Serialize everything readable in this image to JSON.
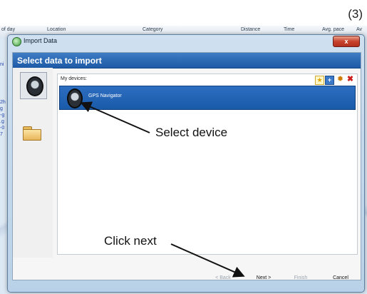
{
  "step_number": "(3)",
  "background_app": {
    "columns": [
      "of day",
      "Location",
      "Category",
      "Distance",
      "Time",
      "Avg. pace",
      "Av"
    ],
    "side_fragments": [
      "ni",
      "2h",
      "g",
      "-g",
      ".g",
      "-0",
      "7"
    ]
  },
  "dialog": {
    "title": "Import Data",
    "close_glyph": "x",
    "header_title": "Select data to import",
    "my_devices_label": "My devices:",
    "devices": [
      {
        "name": "GPS Navigator",
        "selected": true
      }
    ],
    "toolbar_icons": [
      "star-icon",
      "add-icon",
      "gear-icon",
      "delete-icon"
    ],
    "buttons": {
      "back": "< Back",
      "next": "Next >",
      "finish": "Finish",
      "cancel": "Cancel"
    }
  },
  "annotations": {
    "select_device": "Select device",
    "click_next": "Click next"
  },
  "colors": {
    "header_blue": "#1e5aa6",
    "selection_blue": "#1a5aa9",
    "close_red": "#c7432d"
  }
}
